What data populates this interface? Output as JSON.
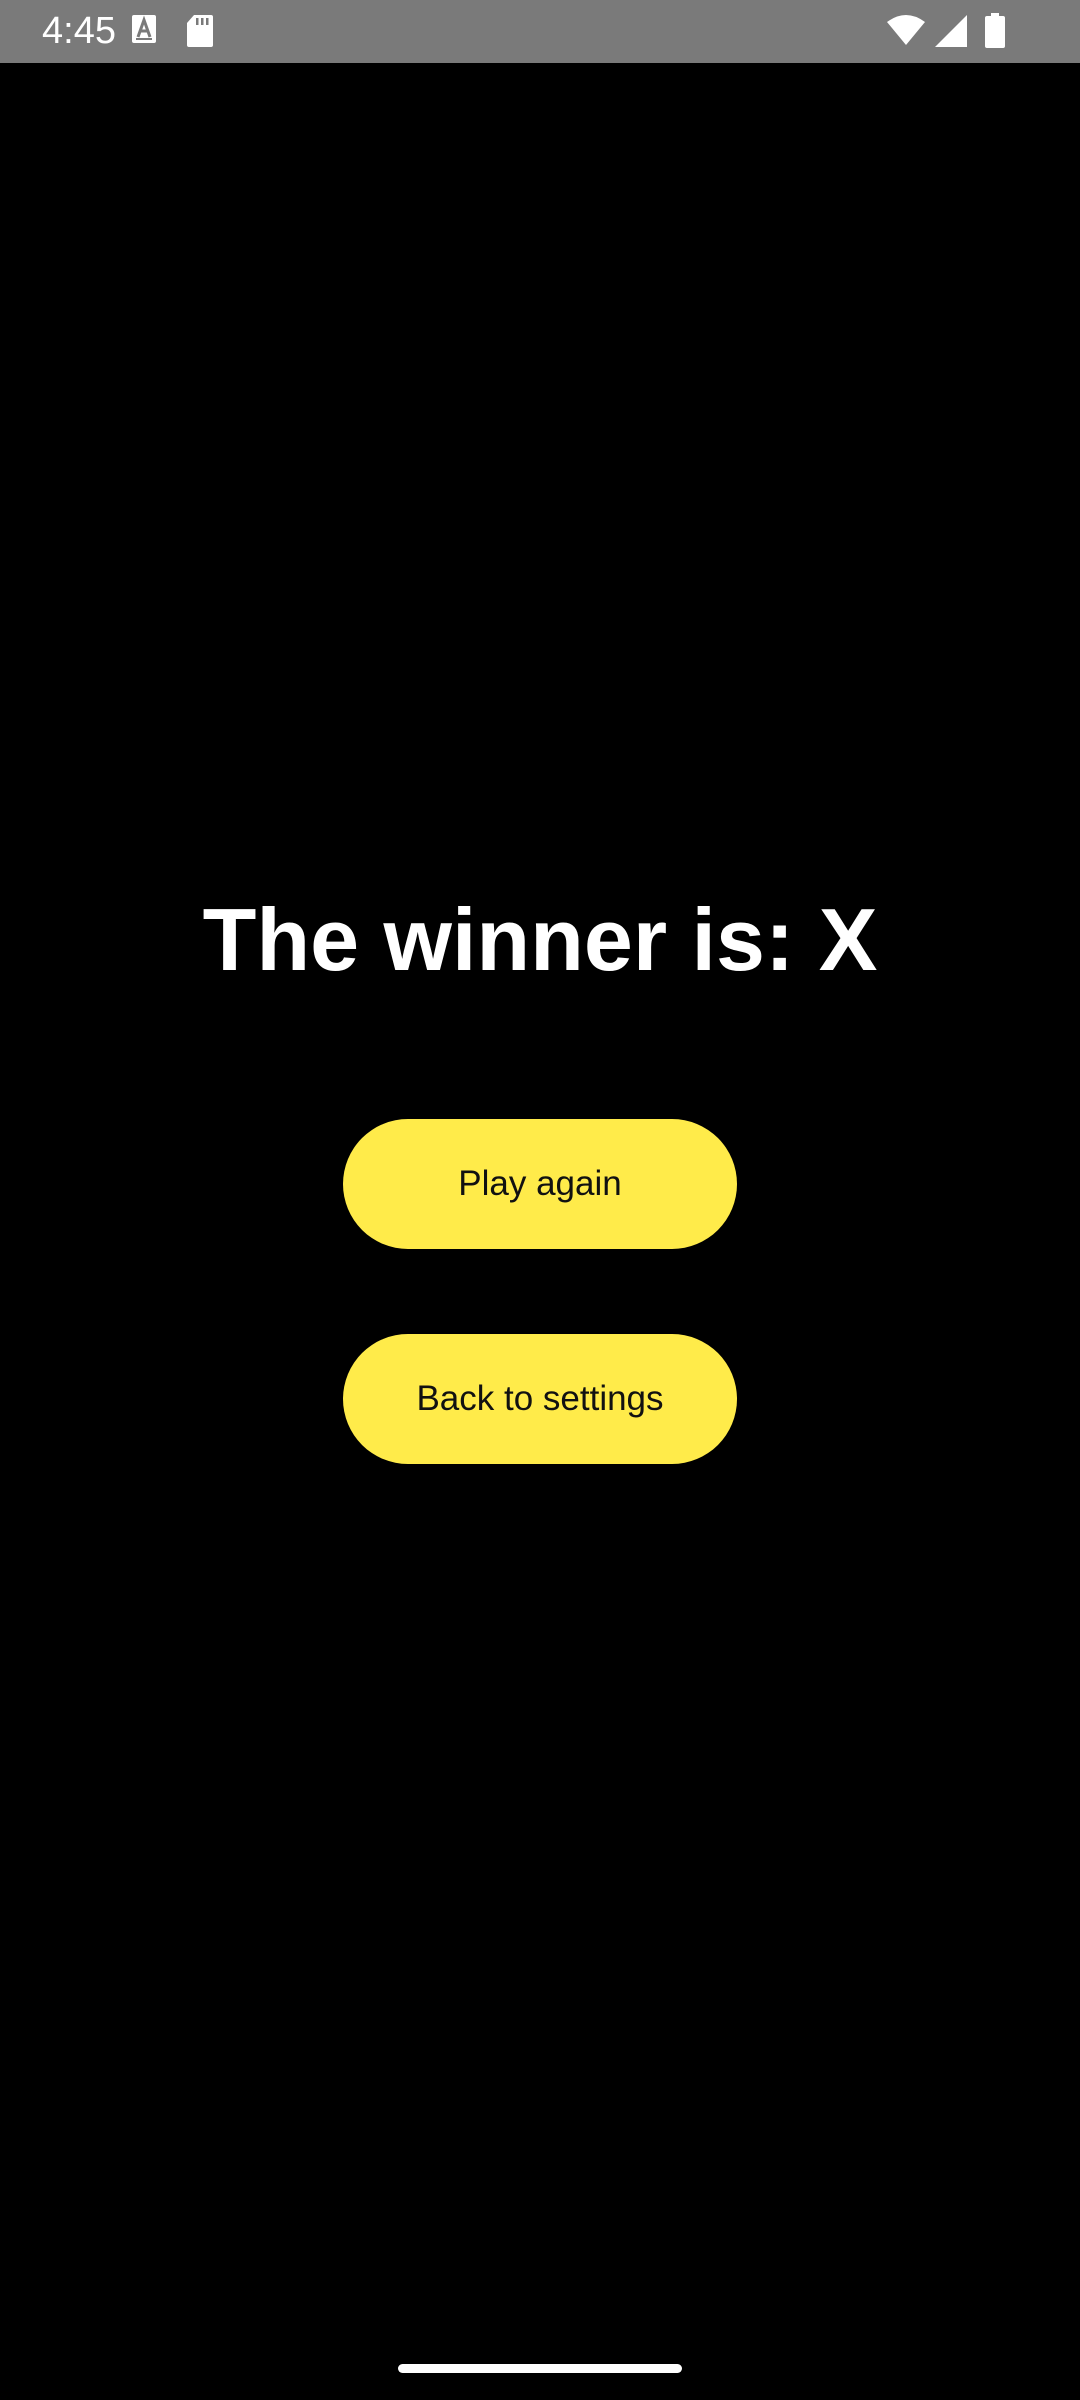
{
  "status_bar": {
    "time": "4:45",
    "background": "#7a7a7a",
    "icons": [
      "text-a-icon",
      "sd-card-icon",
      "wifi-icon",
      "cellular-signal-icon",
      "battery-icon"
    ]
  },
  "result": {
    "title": "The winner is: X"
  },
  "actions": {
    "play_again_label": "Play again",
    "back_to_settings_label": "Back to settings"
  },
  "colors": {
    "background": "#000000",
    "button": "#ffeb4a",
    "button_text": "#111111",
    "title_text": "#ffffff"
  }
}
